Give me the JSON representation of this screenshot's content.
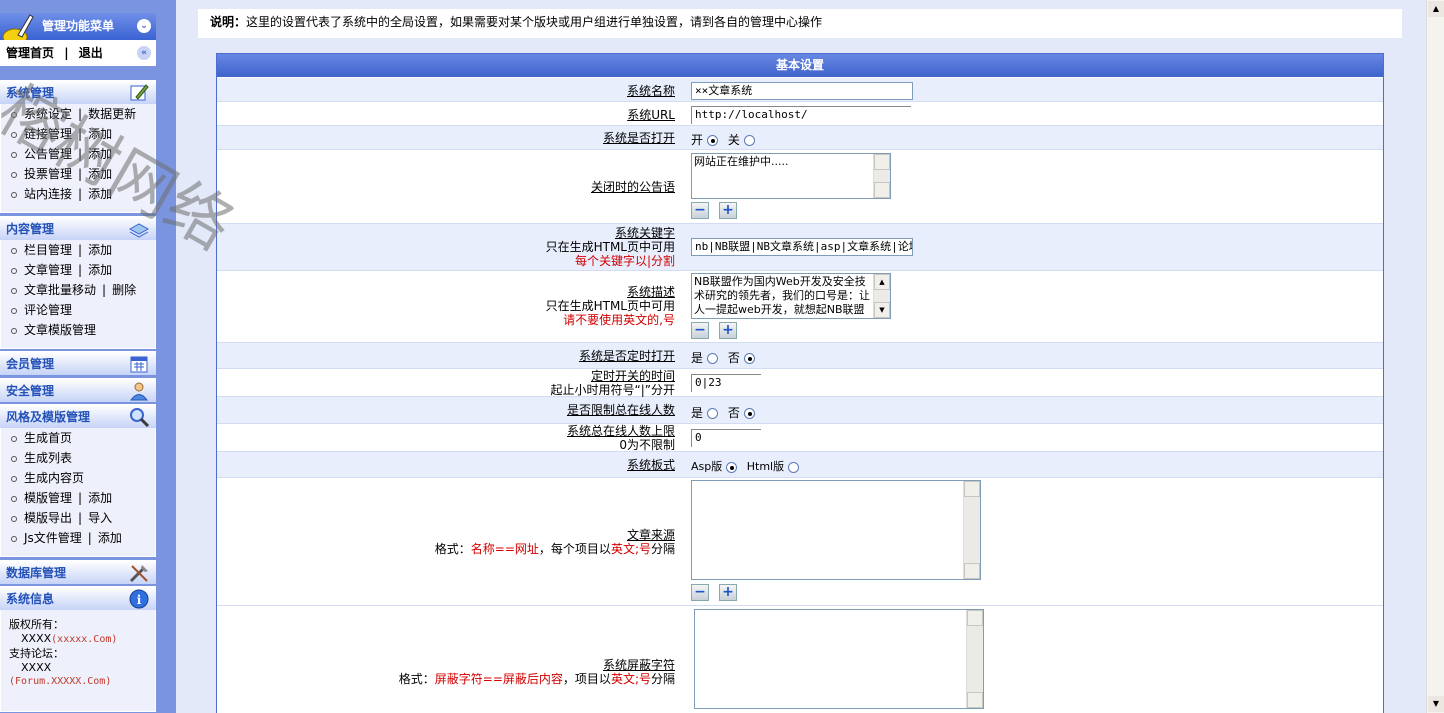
{
  "sidebar": {
    "title": "管理功能菜单",
    "nav": {
      "home": "管理首页",
      "separator": "|",
      "logout": "退出"
    },
    "sections": [
      {
        "title": "系统管理",
        "icon": "edit-icon",
        "items": [
          {
            "a": "系统设定",
            "b": "数据更新"
          },
          {
            "a": "链接管理",
            "b": "添加"
          },
          {
            "a": "公告管理",
            "b": "添加"
          },
          {
            "a": "投票管理",
            "b": "添加"
          },
          {
            "a": "站内连接",
            "b": "添加"
          }
        ]
      },
      {
        "title": "内容管理",
        "icon": "stack-icon",
        "items": [
          {
            "a": "栏目管理",
            "b": "添加"
          },
          {
            "a": "文章管理",
            "b": "添加"
          },
          {
            "a": "文章批量移动",
            "b": "删除"
          },
          {
            "a": "评论管理",
            "b": ""
          },
          {
            "a": "文章模版管理",
            "b": ""
          }
        ]
      },
      {
        "title": "会员管理",
        "icon": "calendar-icon",
        "items": []
      },
      {
        "title": "安全管理",
        "icon": "user-icon",
        "items": []
      },
      {
        "title": "风格及模版管理",
        "icon": "magnifier-icon",
        "items": [
          {
            "a": "生成首页",
            "b": ""
          },
          {
            "a": "生成列表",
            "b": ""
          },
          {
            "a": "生成内容页",
            "b": ""
          },
          {
            "a": "模版管理",
            "b": "添加"
          },
          {
            "a": "模版导出",
            "b": "导入"
          },
          {
            "a": "Js文件管理",
            "b": "添加"
          }
        ]
      },
      {
        "title": "数据库管理",
        "icon": "tools-icon",
        "items": []
      },
      {
        "title": "系统信息",
        "icon": "info-icon",
        "items": []
      }
    ],
    "info": {
      "copyright_label": "版权所有：",
      "copyright_value": "XXXX",
      "copyright_link": "(xxxxx.Com)",
      "forum_label": "支持论坛：",
      "forum_value": "XXXX",
      "forum_link": "(Forum.XXXXX.Com)"
    },
    "watermark": "榕树网络"
  },
  "main": {
    "notice_label": "说明：",
    "notice_text": "这里的设置代表了系统中的全局设置，如果需要对某个版块或用户组进行单独设置，请到各自的管理中心操作",
    "panel_title": "基本设置",
    "fields": {
      "site_name": {
        "label": "系统名称",
        "value": "××文章系统"
      },
      "site_url": {
        "label": "系统URL",
        "value": "http://localhost/"
      },
      "site_open": {
        "label": "系统是否打开",
        "opt1": "开",
        "opt2": "关",
        "selected": "开"
      },
      "close_notice": {
        "label": "关闭时的公告语",
        "value": "网站正在维护中....."
      },
      "keywords": {
        "label": "系统关键字",
        "hint1": "只在生成HTML页中可用",
        "hint2": "每个关键字以|分割",
        "value": "nb|NB联盟|NB文章系统|asp|文章系统|论坛"
      },
      "description": {
        "label": "系统描述",
        "hint1": "只在生成HTML页中可用",
        "hint2": "请不要使用英文的,号",
        "value": "NB联盟作为国内Web开发及安全技术研究的领先者，我们的口号是：让人一提起web开发，就想起NB联盟"
      },
      "timed_open": {
        "label": "系统是否定时打开",
        "opt1": "是",
        "opt2": "否",
        "selected": "否"
      },
      "open_time": {
        "label": "定时开关的时间",
        "hint": "起止小时用符号“|”分开",
        "value": "0|23"
      },
      "limit_online": {
        "label": "是否限制总在线人数",
        "opt1": "是",
        "opt2": "否",
        "selected": "否"
      },
      "max_online": {
        "label": "系统总在线人数上限",
        "hint": "0为不限制",
        "value": "0"
      },
      "version": {
        "label": "系统板式",
        "opt1": "Asp版",
        "opt2": "Html版",
        "selected": "Asp版"
      },
      "sources": {
        "label": "文章来源",
        "hint_a": "格式：",
        "hint_b": "名称==网址",
        "hint_c": "，每个项目以",
        "hint_d": "英文;号",
        "hint_e": "分隔",
        "value": ""
      },
      "filter_words": {
        "label": "系统屏蔽字符",
        "hint_a": "格式：",
        "hint_b": "屏蔽字符==屏蔽后内容",
        "hint_c": "，项目以",
        "hint_d": "英文;号",
        "hint_e": "分隔",
        "value": ""
      }
    },
    "buttons": {
      "shrink": "−",
      "expand": "+"
    }
  }
}
